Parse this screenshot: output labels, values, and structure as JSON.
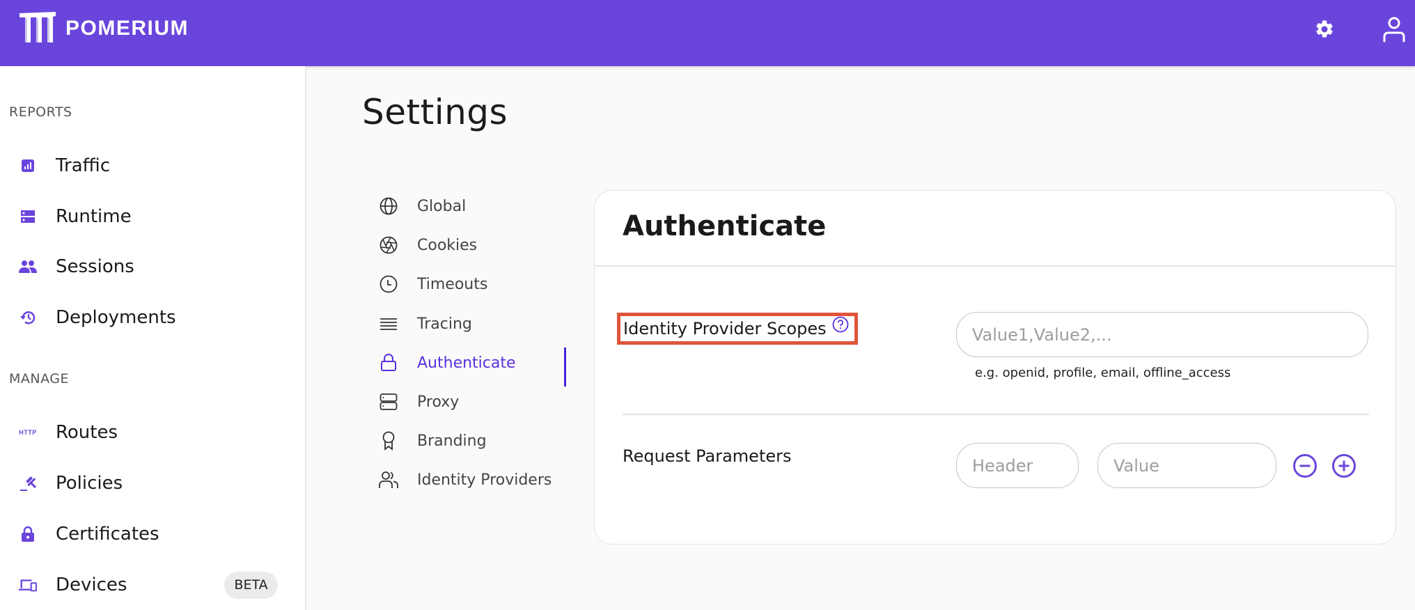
{
  "app": {
    "brand": "POMERIUM",
    "accent_color": "#6a45dc",
    "active_color": "#5b2fe0",
    "highlight_color": "#e0553a"
  },
  "topbar": {
    "icons": [
      "gear-icon",
      "user-icon"
    ]
  },
  "sidebar": {
    "sections": [
      {
        "title": "REPORTS",
        "items": [
          {
            "label": "Traffic",
            "icon": "bar-chart-icon"
          },
          {
            "label": "Runtime",
            "icon": "server-icon"
          },
          {
            "label": "Sessions",
            "icon": "people-icon"
          },
          {
            "label": "Deployments",
            "icon": "history-icon"
          }
        ]
      },
      {
        "title": "MANAGE",
        "items": [
          {
            "label": "Routes",
            "icon": "http-icon",
            "icon_text": "HTTP"
          },
          {
            "label": "Policies",
            "icon": "gavel-icon"
          },
          {
            "label": "Certificates",
            "icon": "lock-icon"
          },
          {
            "label": "Devices",
            "icon": "devices-icon",
            "badge": "BETA"
          }
        ]
      }
    ]
  },
  "page": {
    "title": "Settings"
  },
  "settings_nav": {
    "active": "Authenticate",
    "items": [
      {
        "label": "Global",
        "icon": "globe-icon"
      },
      {
        "label": "Cookies",
        "icon": "aperture-icon"
      },
      {
        "label": "Timeouts",
        "icon": "clock-icon"
      },
      {
        "label": "Tracing",
        "icon": "lines-icon"
      },
      {
        "label": "Authenticate",
        "icon": "lock-outline-icon"
      },
      {
        "label": "Proxy",
        "icon": "server-outline-icon"
      },
      {
        "label": "Branding",
        "icon": "award-icon"
      },
      {
        "label": "Identity Providers",
        "icon": "users-icon"
      }
    ]
  },
  "card": {
    "title": "Authenticate",
    "scopes": {
      "label": "Identity Provider Scopes",
      "value": "",
      "placeholder": "Value1,Value2,...",
      "helper": "e.g. openid, profile, email, offline_access"
    },
    "request_params": {
      "label": "Request Parameters",
      "header_placeholder": "Header",
      "value_placeholder": "Value",
      "header_value": "",
      "value_value": ""
    }
  }
}
